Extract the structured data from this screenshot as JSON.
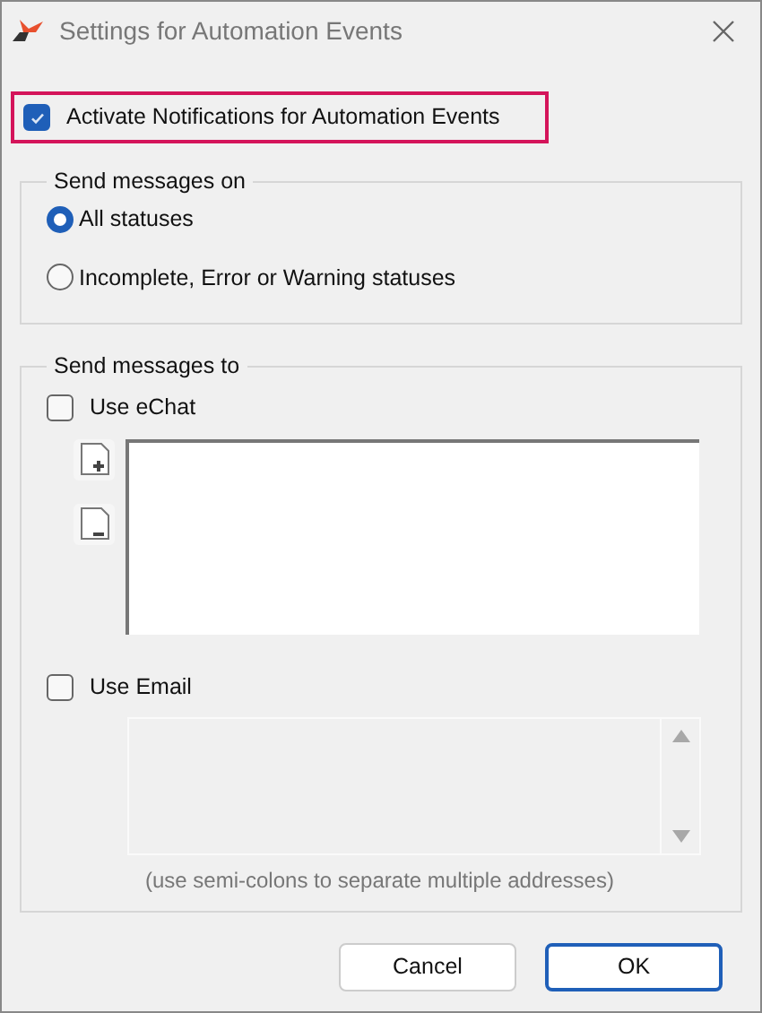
{
  "window": {
    "title": "Settings for Automation Events"
  },
  "activate": {
    "label": "Activate Notifications for Automation Events",
    "checked": true,
    "highlighted": true
  },
  "send_on": {
    "legend": "Send messages on",
    "options": [
      {
        "label": "All statuses",
        "selected": true
      },
      {
        "label": "Incomplete, Error or Warning statuses",
        "selected": false
      }
    ]
  },
  "send_to": {
    "legend": "Send messages to",
    "echat": {
      "label": "Use eChat",
      "checked": false,
      "list_disabled": false
    },
    "email": {
      "label": "Use Email",
      "checked": false,
      "field_disabled": true,
      "hint": "(use semi-colons to separate multiple addresses)"
    }
  },
  "buttons": [
    {
      "label": "Cancel",
      "default": false
    },
    {
      "label": "OK",
      "default": true
    }
  ]
}
